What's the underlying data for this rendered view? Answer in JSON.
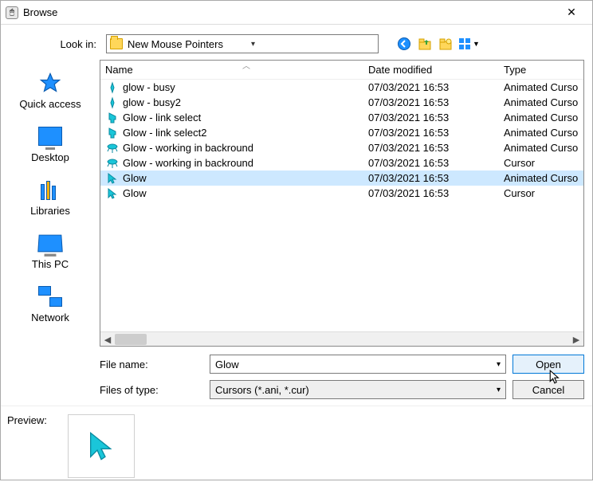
{
  "window": {
    "title": "Browse"
  },
  "lookin": {
    "label": "Look in:",
    "folder": "New Mouse Pointers"
  },
  "sidebar": {
    "items": [
      {
        "label": "Quick access"
      },
      {
        "label": "Desktop"
      },
      {
        "label": "Libraries"
      },
      {
        "label": "This PC"
      },
      {
        "label": "Network"
      }
    ]
  },
  "columns": {
    "name": "Name",
    "date": "Date modified",
    "type": "Type"
  },
  "files": {
    "items": [
      {
        "name": "glow - busy",
        "date": "07/03/2021 16:53",
        "type": "Animated Cursor",
        "icon": "A",
        "selected": false
      },
      {
        "name": "glow - busy2",
        "date": "07/03/2021 16:53",
        "type": "Animated Cursor",
        "icon": "A",
        "selected": false
      },
      {
        "name": "Glow - link select",
        "date": "07/03/2021 16:53",
        "type": "Animated Cursor",
        "icon": "B",
        "selected": false
      },
      {
        "name": "Glow - link select2",
        "date": "07/03/2021 16:53",
        "type": "Animated Cursor",
        "icon": "B",
        "selected": false
      },
      {
        "name": "Glow - working in backround",
        "date": "07/03/2021 16:53",
        "type": "Animated Cursor",
        "icon": "C",
        "selected": false
      },
      {
        "name": "Glow - working in backround",
        "date": "07/03/2021 16:53",
        "type": "Cursor",
        "icon": "C",
        "selected": false
      },
      {
        "name": "Glow",
        "date": "07/03/2021 16:53",
        "type": "Animated Cursor",
        "icon": "D",
        "selected": true
      },
      {
        "name": "Glow",
        "date": "07/03/2021 16:53",
        "type": "Cursor",
        "icon": "D",
        "selected": false
      }
    ]
  },
  "filename": {
    "label": "File name:",
    "value": "Glow"
  },
  "filetype": {
    "label": "Files of type:",
    "value": "Cursors (*.ani, *.cur)"
  },
  "buttons": {
    "open": "Open",
    "cancel": "Cancel"
  },
  "preview": {
    "label": "Preview:"
  }
}
